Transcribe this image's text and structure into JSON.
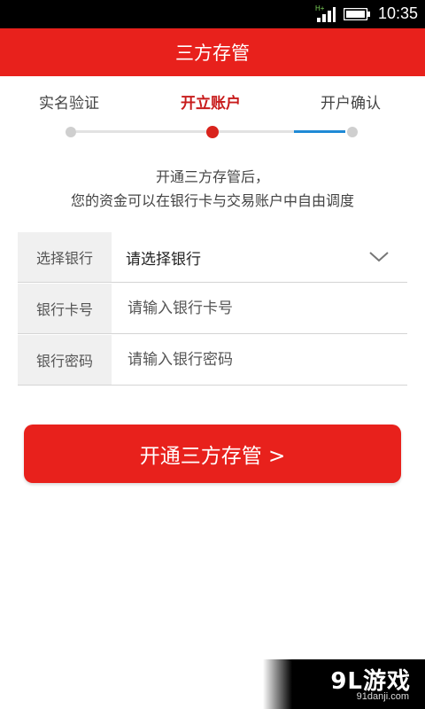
{
  "status_bar": {
    "time": "10:35",
    "signal_tag": "H+"
  },
  "header": {
    "title": "三方存管"
  },
  "steps": {
    "items": [
      {
        "label": "实名验证",
        "state": "done"
      },
      {
        "label": "开立账户",
        "state": "active"
      },
      {
        "label": "开户确认",
        "state": "pending"
      }
    ]
  },
  "intro": {
    "line1": "开通三方存管后，",
    "line2": "您的资金可以在银行卡与交易账户中自由调度"
  },
  "form": {
    "bank_label": "选择银行",
    "bank_value": "请选择银行",
    "card_label": "银行卡号",
    "card_placeholder": "请输入银行卡号",
    "password_label": "银行密码",
    "password_placeholder": "请输入银行密码"
  },
  "submit_label": "开通三方存管 >",
  "watermark": {
    "logo": "9L游戏",
    "url": "91danji.com"
  },
  "colors": {
    "brand_red": "#e8211c",
    "step_blue": "#1f8ad6"
  }
}
